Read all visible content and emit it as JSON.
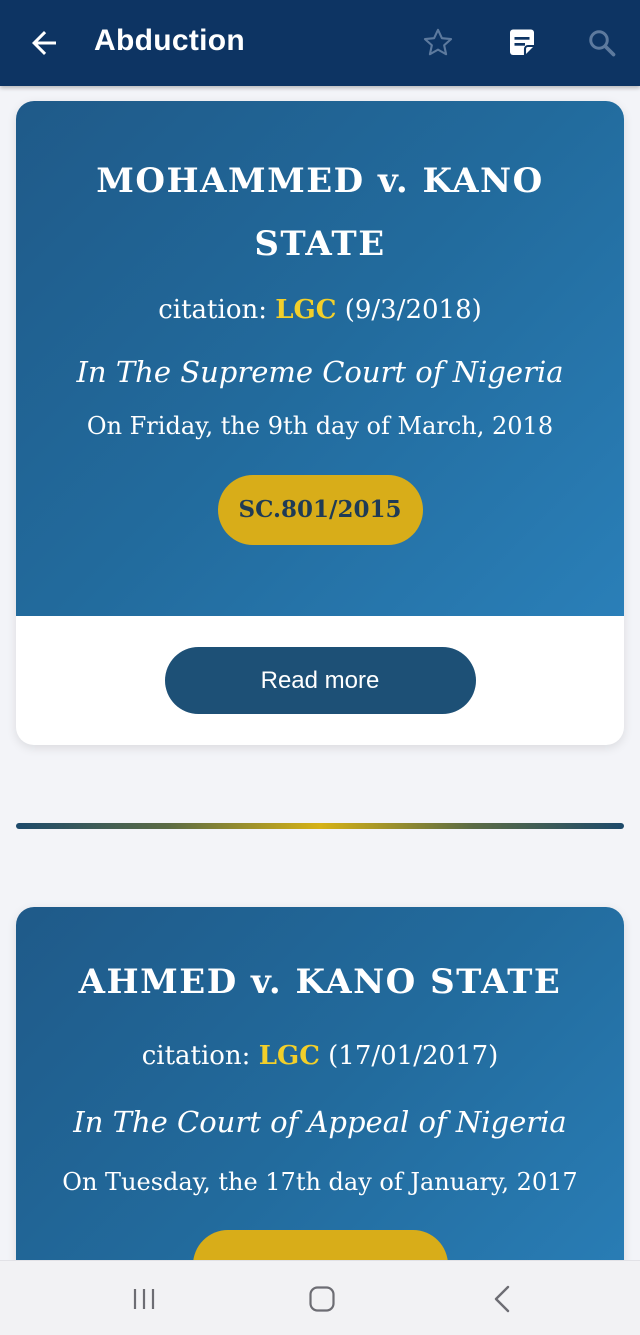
{
  "appbar": {
    "title": "Abduction",
    "back_icon": "arrow-left-icon",
    "actions": [
      "star-icon",
      "notes-icon",
      "search-icon"
    ],
    "background": "#0d3463"
  },
  "cases": [
    {
      "title": "MOHAMMED v. KANO STATE",
      "citation_prefix": "citation: ",
      "citation_code": "LGC",
      "citation_date": " (9/3/2018)",
      "court": "In The Supreme Court of Nigeria",
      "date": "On Friday, the 9th day of March, 2018",
      "suit_number": "SC.801/2015",
      "read_more": "Read more"
    },
    {
      "title": "AHMED v. KANO STATE",
      "citation_prefix": "citation: ",
      "citation_code": "LGC",
      "citation_date": " (17/01/2017)",
      "court": "In The Court of Appeal of Nigeria",
      "date": "On Tuesday, the 17th day of January, 2017"
    }
  ],
  "colors": {
    "citation_highlight": "#f2cf2a",
    "suit_badge": "#d8ad19",
    "read_more_button": "#1d5076"
  },
  "system_nav": [
    "recent-apps-icon",
    "home-icon",
    "back-icon"
  ]
}
